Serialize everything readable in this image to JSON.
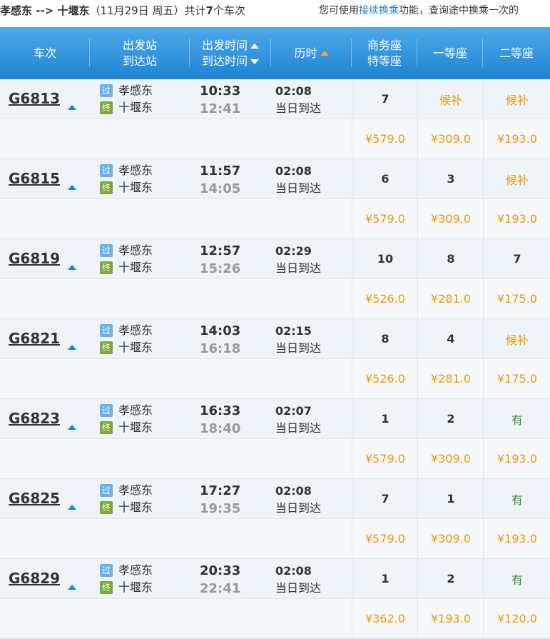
{
  "header": {
    "from": "孝感东",
    "arrow": " --> ",
    "to": "十堰东",
    "date": "（11月29日  周五）",
    "count_prefix": "共计",
    "count": "7",
    "count_suffix": "个车次",
    "tip_prefix": "您可使用",
    "tip_link": "接续换乘",
    "tip_suffix": "功能，查询途中换乘一次的"
  },
  "columns": {
    "train": "车次",
    "dep_station": "出发站",
    "arr_station": "到达站",
    "dep_time": "出发时间",
    "arr_time": "到达时间",
    "duration": "历时",
    "business1": "商务座",
    "business2": "特等座",
    "first": "一等座",
    "second": "二等座"
  },
  "badges": {
    "pass": "过",
    "end": "终"
  },
  "colors": {
    "header_bg": "#1e84d2",
    "price": "#f39800",
    "available": "#2a9a2a",
    "waitlist": "#f39800"
  },
  "trains": [
    {
      "no": "G6813",
      "from": "孝感东",
      "to": "十堰东",
      "dep": "10:33",
      "arr": "12:41",
      "dur": "02:08",
      "arrive_day": "当日到达",
      "business": "7",
      "first": "候补",
      "second": "候补",
      "p_business": "¥579.0",
      "p_first": "¥309.0",
      "p_second": "¥193.0"
    },
    {
      "no": "G6815",
      "from": "孝感东",
      "to": "十堰东",
      "dep": "11:57",
      "arr": "14:05",
      "dur": "02:08",
      "arrive_day": "当日到达",
      "business": "6",
      "first": "3",
      "second": "候补",
      "p_business": "¥579.0",
      "p_first": "¥309.0",
      "p_second": "¥193.0"
    },
    {
      "no": "G6819",
      "from": "孝感东",
      "to": "十堰东",
      "dep": "12:57",
      "arr": "15:26",
      "dur": "02:29",
      "arrive_day": "当日到达",
      "business": "10",
      "first": "8",
      "second": "7",
      "p_business": "¥526.0",
      "p_first": "¥281.0",
      "p_second": "¥175.0"
    },
    {
      "no": "G6821",
      "from": "孝感东",
      "to": "十堰东",
      "dep": "14:03",
      "arr": "16:18",
      "dur": "02:15",
      "arrive_day": "当日到达",
      "business": "8",
      "first": "4",
      "second": "候补",
      "p_business": "¥526.0",
      "p_first": "¥281.0",
      "p_second": "¥175.0"
    },
    {
      "no": "G6823",
      "from": "孝感东",
      "to": "十堰东",
      "dep": "16:33",
      "arr": "18:40",
      "dur": "02:07",
      "arrive_day": "当日到达",
      "business": "1",
      "first": "2",
      "second": "有",
      "p_business": "¥579.0",
      "p_first": "¥309.0",
      "p_second": "¥193.0"
    },
    {
      "no": "G6825",
      "from": "孝感东",
      "to": "十堰东",
      "dep": "17:27",
      "arr": "19:35",
      "dur": "02:08",
      "arrive_day": "当日到达",
      "business": "7",
      "first": "1",
      "second": "有",
      "p_business": "¥579.0",
      "p_first": "¥309.0",
      "p_second": "¥193.0"
    },
    {
      "no": "G6829",
      "from": "孝感东",
      "to": "十堰东",
      "dep": "20:33",
      "arr": "22:41",
      "dur": "02:08",
      "arrive_day": "当日到达",
      "business": "1",
      "first": "2",
      "second": "有",
      "p_business": "¥362.0",
      "p_first": "¥193.0",
      "p_second": "¥120.0"
    }
  ]
}
